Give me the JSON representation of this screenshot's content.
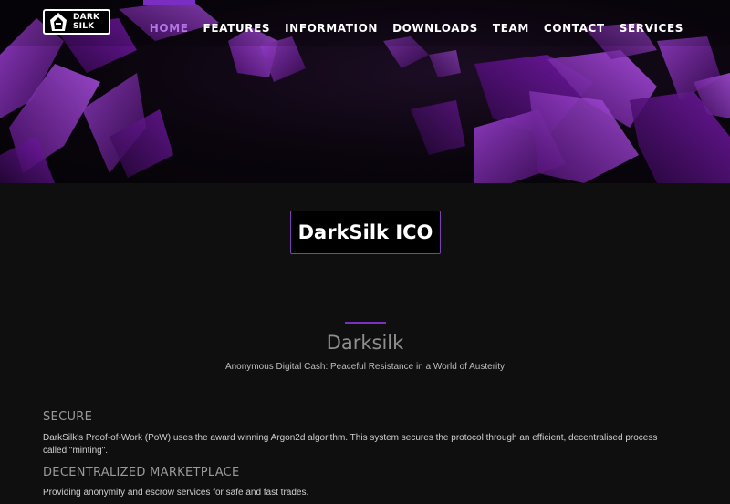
{
  "logo": {
    "line1": "DARK",
    "line2": "SILK"
  },
  "nav": {
    "items": [
      {
        "label": "HOME",
        "active": true
      },
      {
        "label": "FEATURES",
        "active": false
      },
      {
        "label": "INFORMATION",
        "active": false
      },
      {
        "label": "DOWNLOADS",
        "active": false
      },
      {
        "label": "TEAM",
        "active": false
      },
      {
        "label": "CONTACT",
        "active": false
      },
      {
        "label": "SERVICES",
        "active": false
      }
    ]
  },
  "hero": {
    "ico_button_label": "DarkSilk ICO"
  },
  "about": {
    "title": "Darksilk",
    "subtitle": "Anonymous Digital Cash: Peaceful Resistance in a World of Austerity"
  },
  "features": [
    {
      "heading": "SECURE",
      "text": "DarkSilk's Proof-of-Work (PoW) uses the award winning Argon2d algorithm. This system secures the protocol through an efficient, decentralised process called \"minting\"."
    },
    {
      "heading": "DECENTRALIZED MARKETPLACE",
      "text": "Providing anonymity and escrow services for safe and fast trades."
    }
  ],
  "colors": {
    "accent": "#7a2fc2",
    "nav_active": "#b473e6",
    "background": "#0f0f0f",
    "crystal": "#6a1596"
  }
}
